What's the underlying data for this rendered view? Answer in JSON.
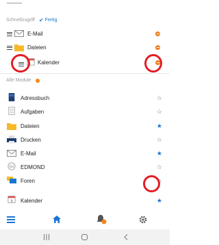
{
  "quick_access": {
    "title": "Schnellzugriff",
    "done_label": "Fertig",
    "items": [
      {
        "label": "E-Mail",
        "icon": "mail-icon"
      },
      {
        "label": "Dateien",
        "icon": "folder-icon"
      },
      {
        "label": "Kalender",
        "icon": "calendar-icon"
      }
    ]
  },
  "all_modules": {
    "title": "Alle Module",
    "items": [
      {
        "label": "Adressbuch",
        "icon": "address-book-icon",
        "starred": false
      },
      {
        "label": "Aufgaben",
        "icon": "tasks-icon",
        "starred": false
      },
      {
        "label": "Dateien",
        "icon": "folder-icon",
        "starred": true
      },
      {
        "label": "Drucken",
        "icon": "printer-icon",
        "starred": false
      },
      {
        "label": "E-Mail",
        "icon": "mail-icon",
        "starred": true
      },
      {
        "label": "EDMOND",
        "icon": "edmond-icon",
        "starred": false
      },
      {
        "label": "Foren",
        "icon": "forum-icon",
        "starred": false
      },
      {
        "label": "Kalender",
        "icon": "calendar-icon",
        "starred": true
      }
    ]
  },
  "bottom_nav": [
    "menu-icon",
    "home-icon",
    "notification-bell-icon",
    "settings-gear-icon"
  ],
  "colors": {
    "accent_blue": "#1976d2",
    "orange": "#f5861f",
    "highlight_red": "#e11d24"
  }
}
